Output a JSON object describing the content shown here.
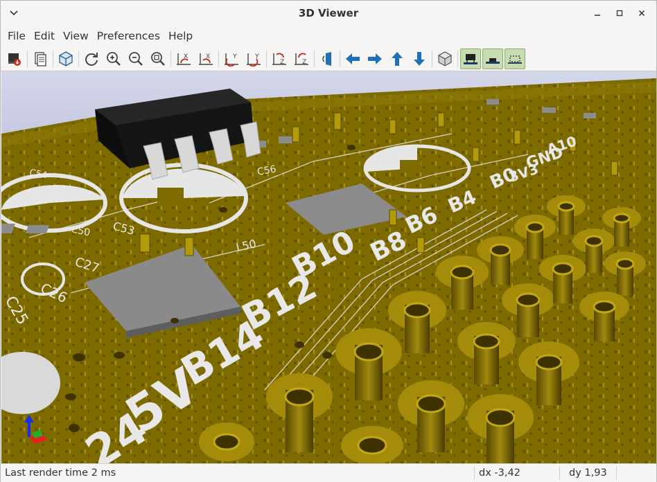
{
  "window": {
    "title": "3D Viewer"
  },
  "menubar": {
    "items": [
      "File",
      "Edit",
      "View",
      "Preferences",
      "Help"
    ]
  },
  "toolbar": {
    "buttons": [
      {
        "icon": "render-raytrace-icon"
      },
      {
        "icon": "copy-to-clipboard-icon"
      },
      {
        "icon": "board-3d-icon"
      },
      {
        "icon": "reload-icon"
      },
      {
        "icon": "zoom-in-icon"
      },
      {
        "icon": "zoom-out-icon"
      },
      {
        "icon": "zoom-fit-icon"
      },
      {
        "icon": "rotate-x-ccw-icon"
      },
      {
        "icon": "rotate-x-cw-icon"
      },
      {
        "icon": "rotate-y-ccw-icon"
      },
      {
        "icon": "rotate-y-cw-icon"
      },
      {
        "icon": "rotate-z-ccw-icon"
      },
      {
        "icon": "rotate-z-cw-icon"
      },
      {
        "icon": "flip-board-icon"
      },
      {
        "icon": "arrow-left-icon"
      },
      {
        "icon": "arrow-right-icon"
      },
      {
        "icon": "arrow-up-icon"
      },
      {
        "icon": "arrow-down-icon"
      },
      {
        "icon": "ortho-projection-icon"
      },
      {
        "icon": "show-tht-icon"
      },
      {
        "icon": "show-smd-icon"
      },
      {
        "icon": "show-virtual-icon"
      }
    ]
  },
  "scene": {
    "silk_labels": [
      "B10",
      "B12",
      "B14",
      "5V",
      "24",
      "B8",
      "B6",
      "B4",
      "B0",
      "C56",
      "C53",
      "L50",
      "C27",
      "C26",
      "C25",
      "C50",
      "C54",
      "GND",
      "A10",
      "3V3"
    ]
  },
  "statusbar": {
    "render_time": "Last render time 2 ms",
    "dx": "dx -3,42",
    "dy": "dy 1,93"
  },
  "colors": {
    "board": "#7a6a00",
    "copper": "#b39a0a",
    "silkscreen": "#e6e6e6",
    "pad_gray": "#8a8a8a",
    "background_top": "#cdd0e6",
    "background_bottom": "#7f84ab"
  }
}
